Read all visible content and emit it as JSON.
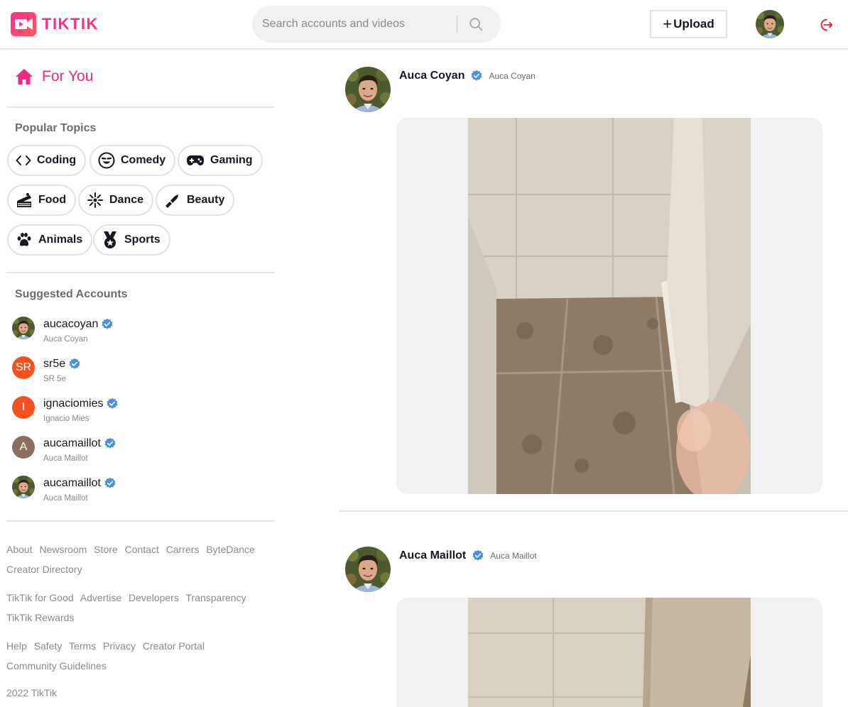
{
  "app": {
    "name": "TIKTIK",
    "brand_color": "#fe2c8b",
    "accent_color": "#f32683",
    "verified_color": "#4a90e2"
  },
  "header": {
    "search_placeholder": "Search accounts and videos",
    "upload_label": "Upload",
    "icons": [
      "search-icon",
      "plus-icon",
      "logout-icon"
    ]
  },
  "sidebar": {
    "for_you_label": "For You",
    "popular_topics_title": "Popular Topics",
    "topics": [
      {
        "label": "Coding",
        "icon": "code-icon"
      },
      {
        "label": "Comedy",
        "icon": "laughing-face-icon"
      },
      {
        "label": "Gaming",
        "icon": "gamepad-icon"
      },
      {
        "label": "Food",
        "icon": "cake-icon"
      },
      {
        "label": "Dance",
        "icon": "dancer-icon"
      },
      {
        "label": "Beauty",
        "icon": "lipstick-icon"
      },
      {
        "label": "Animals",
        "icon": "paw-icon"
      },
      {
        "label": "Sports",
        "icon": "medal-icon"
      }
    ],
    "suggested_title": "Suggested Accounts",
    "accounts": [
      {
        "username": "aucacoyan",
        "name": "Auca Coyan",
        "avatar": "photo"
      },
      {
        "username": "sr5e",
        "name": "SR 5e",
        "avatar": "SR",
        "avatar_color": "#f4511e"
      },
      {
        "username": "ignaciomies",
        "name": "Ignacio Mies",
        "avatar": "I",
        "avatar_color": "#f4511e"
      },
      {
        "username": "aucamaillot",
        "name": "Auca Maillot",
        "avatar": "A",
        "avatar_color": "#8d6e63"
      },
      {
        "username": "aucamaillot",
        "name": "Auca Maillot",
        "avatar": "photo"
      }
    ],
    "footer": {
      "group1": [
        "About",
        "Newsroom",
        "Store",
        "Contact",
        "Carrers",
        "ByteDance",
        "Creator Directory"
      ],
      "group2": [
        "TikTik for Good",
        "Advertise",
        "Developers",
        "Transparency",
        "TikTik Rewards"
      ],
      "group3": [
        "Help",
        "Safety",
        "Terms",
        "Privacy",
        "Creator Portal",
        "Community Guidelines"
      ],
      "copyright": "2022 TikTik"
    }
  },
  "feed": {
    "posts": [
      {
        "display_name": "Auca Coyan",
        "handle": "Auca Coyan"
      },
      {
        "display_name": "Auca Maillot",
        "handle": "Auca Maillot"
      }
    ]
  }
}
